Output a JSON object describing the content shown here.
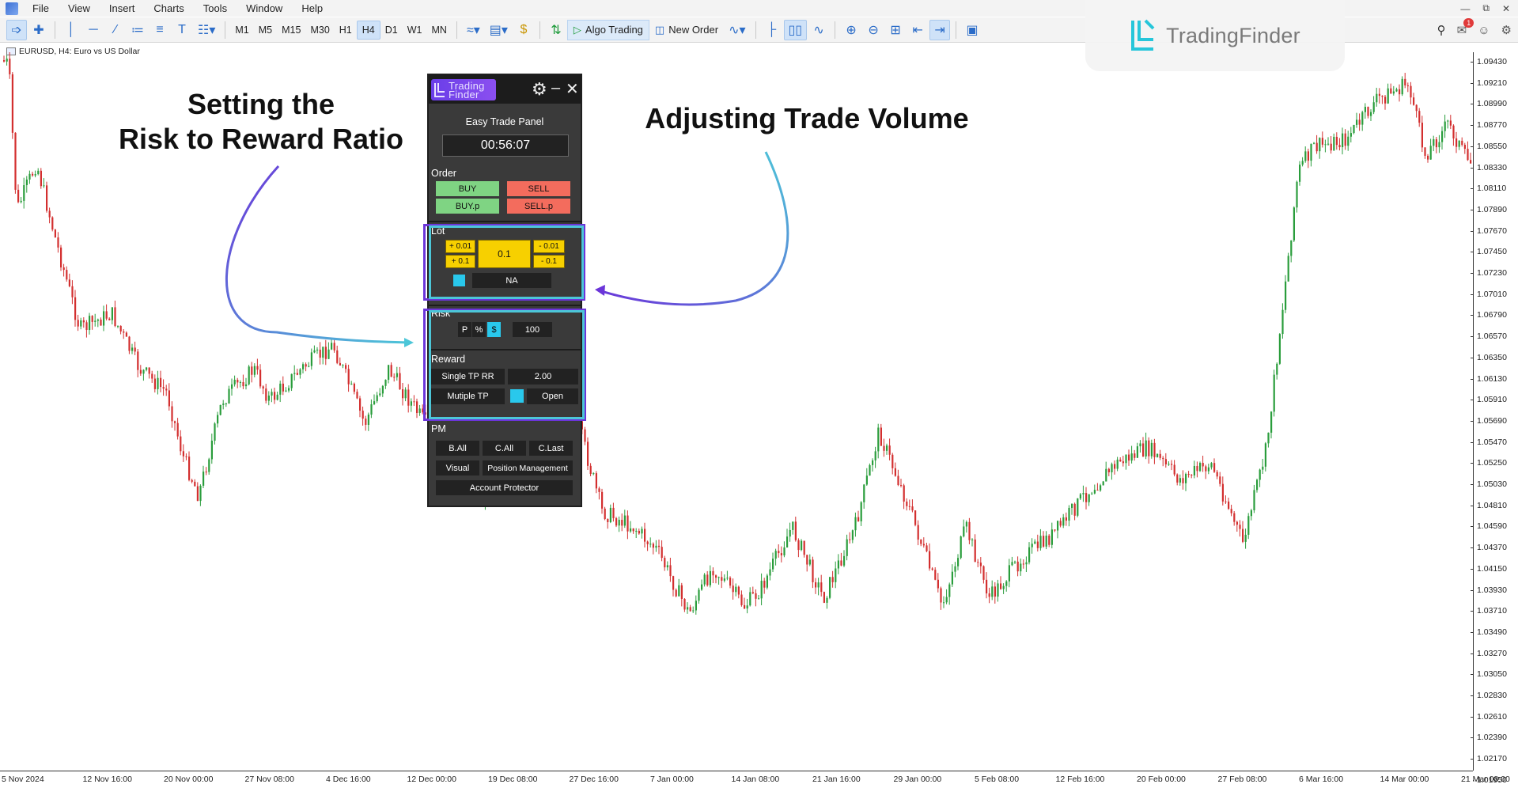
{
  "menu": {
    "items": [
      "File",
      "View",
      "Insert",
      "Charts",
      "Tools",
      "Window",
      "Help"
    ]
  },
  "toolbar": {
    "timeframes": [
      "M1",
      "M5",
      "M15",
      "M30",
      "H1",
      "H4",
      "D1",
      "W1",
      "MN"
    ],
    "active_timeframe": "H4",
    "algo_trading_label": "Algo Trading",
    "new_order_label": "New Order",
    "notification_count": "1"
  },
  "chart": {
    "symbol_label": "EURUSD, H4:  Euro vs US Dollar",
    "up_color": "#2a9d3c",
    "down_color": "#d32f2f",
    "price_levels": [
      "1.09430",
      "1.09210",
      "1.08990",
      "1.08770",
      "1.08550",
      "1.08330",
      "1.08110",
      "1.07890",
      "1.07670",
      "1.07450",
      "1.07230",
      "1.07010",
      "1.06790",
      "1.06570",
      "1.06350",
      "1.06130",
      "1.05910",
      "1.05690",
      "1.05470",
      "1.05250",
      "1.05030",
      "1.04810",
      "1.04590",
      "1.04370",
      "1.04150",
      "1.03930",
      "1.03710",
      "1.03490",
      "1.03270",
      "1.03050",
      "1.02830",
      "1.02610",
      "1.02390",
      "1.02170",
      "1.01950"
    ],
    "time_labels": [
      "5 Nov 2024",
      "12 Nov 16:00",
      "20 Nov 00:00",
      "27 Nov 08:00",
      "4 Dec 16:00",
      "12 Dec 00:00",
      "19 Dec 08:00",
      "27 Dec 16:00",
      "7 Jan 00:00",
      "14 Jan 08:00",
      "21 Jan 16:00",
      "29 Jan 00:00",
      "5 Feb 08:00",
      "12 Feb 16:00",
      "20 Feb 00:00",
      "27 Feb 08:00",
      "6 Mar 16:00",
      "14 Mar 00:00",
      "21 Mar 08:00"
    ]
  },
  "watermark": {
    "brand": "TradingFinder",
    "accent": "#26c6da"
  },
  "annotations": {
    "left_line1": "Setting the",
    "left_line2": "Risk to Reward Ratio",
    "right": "Adjusting Trade Volume"
  },
  "panel": {
    "logo_line1": "Trading",
    "logo_line2": "Finder",
    "title": "Easy Trade Panel",
    "timer": "00:56:07",
    "order": {
      "label": "Order",
      "buy": "BUY",
      "sell": "SELL",
      "buy_p": "BUY.p",
      "sell_p": "SELL.p"
    },
    "lot": {
      "label": "Lot",
      "plus_small": "+ 0.01",
      "plus_big": "+ 0.1",
      "value": "0.1",
      "minus_small": "- 0.01",
      "minus_big": "- 0.1",
      "na": "NA"
    },
    "risk": {
      "label": "Risk",
      "mode_p": "P",
      "mode_pct": "%",
      "mode_usd": "$",
      "value": "100"
    },
    "reward": {
      "label": "Reward",
      "single_tp": "Single TP RR",
      "rr_value": "2.00",
      "multiple_tp": "Mutiple TP",
      "open": "Open"
    },
    "pm": {
      "label": "PM",
      "b_all": "B.All",
      "c_all": "C.All",
      "c_last": "C.Last",
      "visual": "Visual",
      "position_management": "Position Management",
      "account_protector": "Account Protector"
    },
    "highlight_purple": "#6b35d9",
    "highlight_cyan": "#4cc6d8"
  }
}
